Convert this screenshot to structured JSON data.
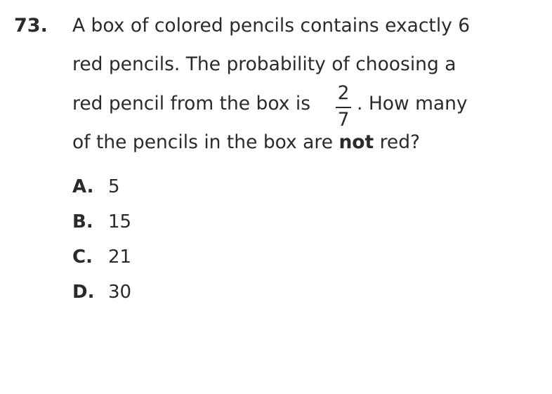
{
  "question": {
    "number": "73.",
    "line1": "A box of colored pencils contains exactly 6",
    "line2": "red pencils. The probability of choosing a",
    "line3_before_fraction": "red pencil from the box is",
    "fraction": {
      "numerator": "2",
      "denominator": "7"
    },
    "line3_after_fraction": ". How many",
    "line4_before": "of the pencils in the box are ",
    "line4_emphasis": "not",
    "line4_after": " red?"
  },
  "choices": [
    {
      "letter": "A.",
      "value": "5"
    },
    {
      "letter": "B.",
      "value": "15"
    },
    {
      "letter": "C.",
      "value": "21"
    },
    {
      "letter": "D.",
      "value": "30"
    }
  ]
}
